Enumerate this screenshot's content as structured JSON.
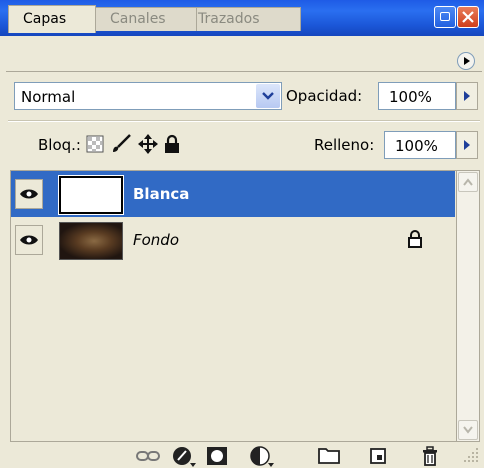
{
  "tabs": [
    {
      "label": "Capas",
      "active": true
    },
    {
      "label": "Canales",
      "active": false
    },
    {
      "label": "Trazados",
      "active": false
    }
  ],
  "blend_mode": {
    "value": "Normal"
  },
  "opacity": {
    "label": "Opacidad:",
    "value": "100%"
  },
  "lock": {
    "label": "Bloq.:"
  },
  "fill": {
    "label": "Relleno:",
    "value": "100%"
  },
  "layers": [
    {
      "name": "Blanca",
      "selected": true,
      "visible": true,
      "locked": false
    },
    {
      "name": "Fondo",
      "selected": false,
      "visible": true,
      "locked": true
    }
  ],
  "colors": {
    "titlebar": "#2a6ff0",
    "selection": "#316ac5",
    "panel": "#ece9d8"
  },
  "icons": [
    "minimize-icon",
    "close-icon",
    "panel-menu-icon",
    "dropdown-arrow-icon",
    "transparency-lock-icon",
    "brush-lock-icon",
    "move-lock-icon",
    "padlock-icon",
    "eye-icon",
    "link-icon",
    "layer-style-icon",
    "mask-icon",
    "adjustment-icon",
    "folder-icon",
    "new-layer-icon",
    "trash-icon"
  ]
}
